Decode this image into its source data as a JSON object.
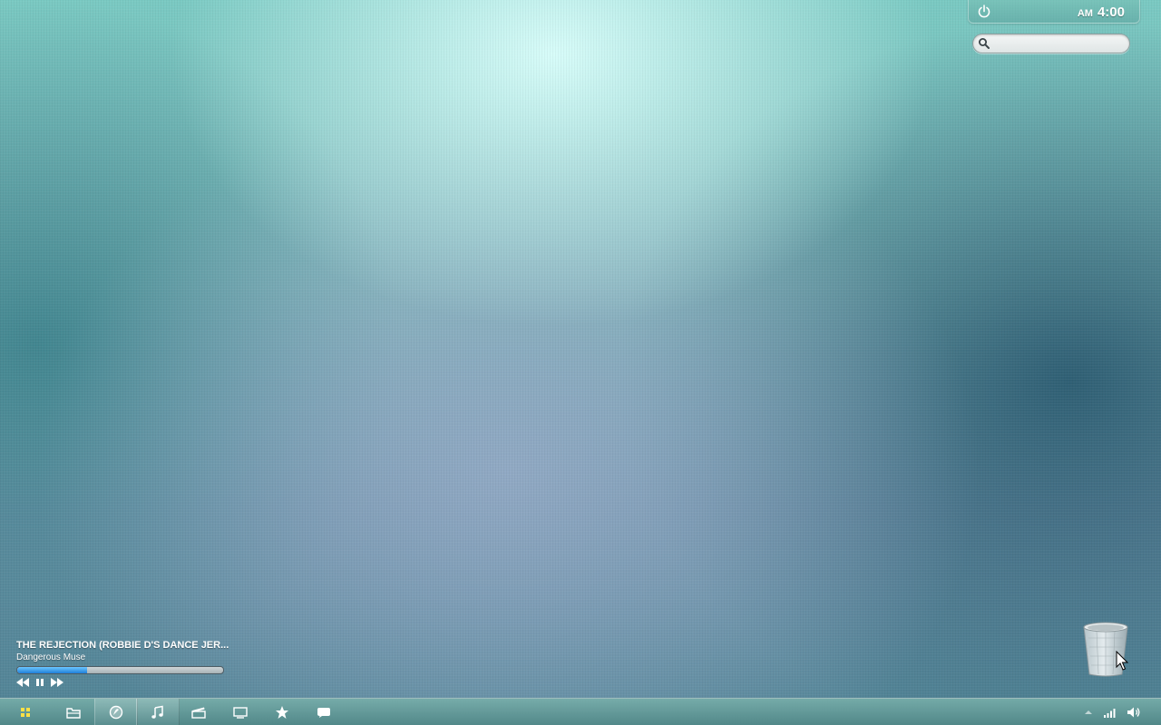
{
  "top_panel": {
    "clock": {
      "ampm": "AM",
      "time": "4:00"
    }
  },
  "search": {
    "placeholder": "",
    "value": ""
  },
  "music_player": {
    "track_title": "THE REJECTION (ROBBIE D'S DANCE JER...",
    "artist": "Dangerous Muse",
    "progress_fraction": 0.34,
    "controls": [
      "previous-icon",
      "pause-icon",
      "next-icon"
    ]
  },
  "taskbar": {
    "items": [
      {
        "icon": "start-menu-icon",
        "active": false
      },
      {
        "icon": "files-icon",
        "active": false
      },
      {
        "icon": "browser-icon",
        "active": true
      },
      {
        "icon": "music-icon",
        "active": true
      },
      {
        "icon": "video-icon",
        "active": false
      },
      {
        "icon": "display-icon",
        "active": false
      },
      {
        "icon": "favorites-icon",
        "active": false
      },
      {
        "icon": "chat-icon",
        "active": false
      }
    ],
    "tray": [
      "tray-arrow-icon",
      "network-signal-icon",
      "volume-icon"
    ]
  },
  "colors": {
    "accent_blue": "#1e7fd8",
    "panel_text": "#ffffff"
  }
}
